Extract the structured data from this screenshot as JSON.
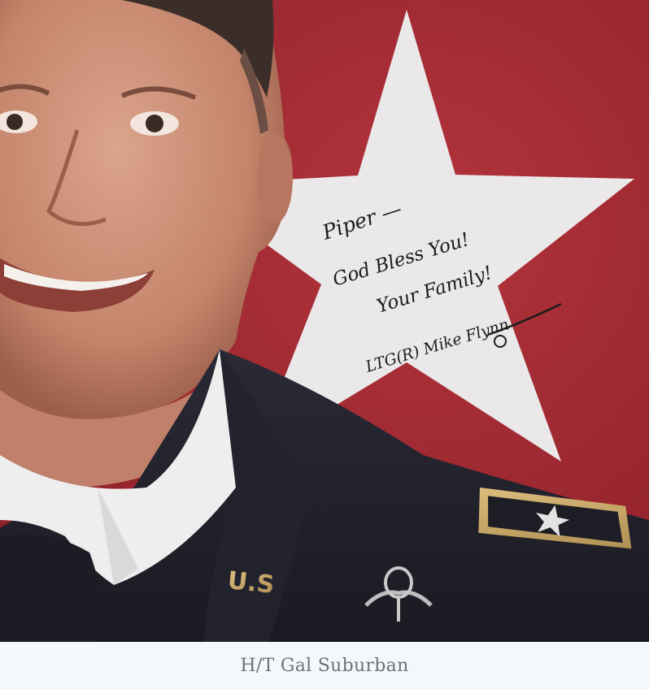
{
  "photo": {
    "subject": "Portrait photograph of a smiling man in a dark army dress uniform in front of a red flag with a large white star, signed with a handwritten note",
    "signature_note": {
      "line1": "Piper —",
      "line2": "God Bless You!",
      "line3": "Your Family!",
      "signature": "LTG(R) Mike Flynn"
    },
    "collar_insignia": "U.S.",
    "colors": {
      "flag_red": "#a12a32",
      "star_white": "#ece9ea",
      "uniform_dark": "#23232e",
      "shirt_white": "#efefef",
      "skin": "#c98f77",
      "gold": "#c9a766"
    }
  },
  "caption": {
    "text": "H/T Gal Suburban",
    "color": "#6b7378",
    "background": "#f3f9fb"
  }
}
